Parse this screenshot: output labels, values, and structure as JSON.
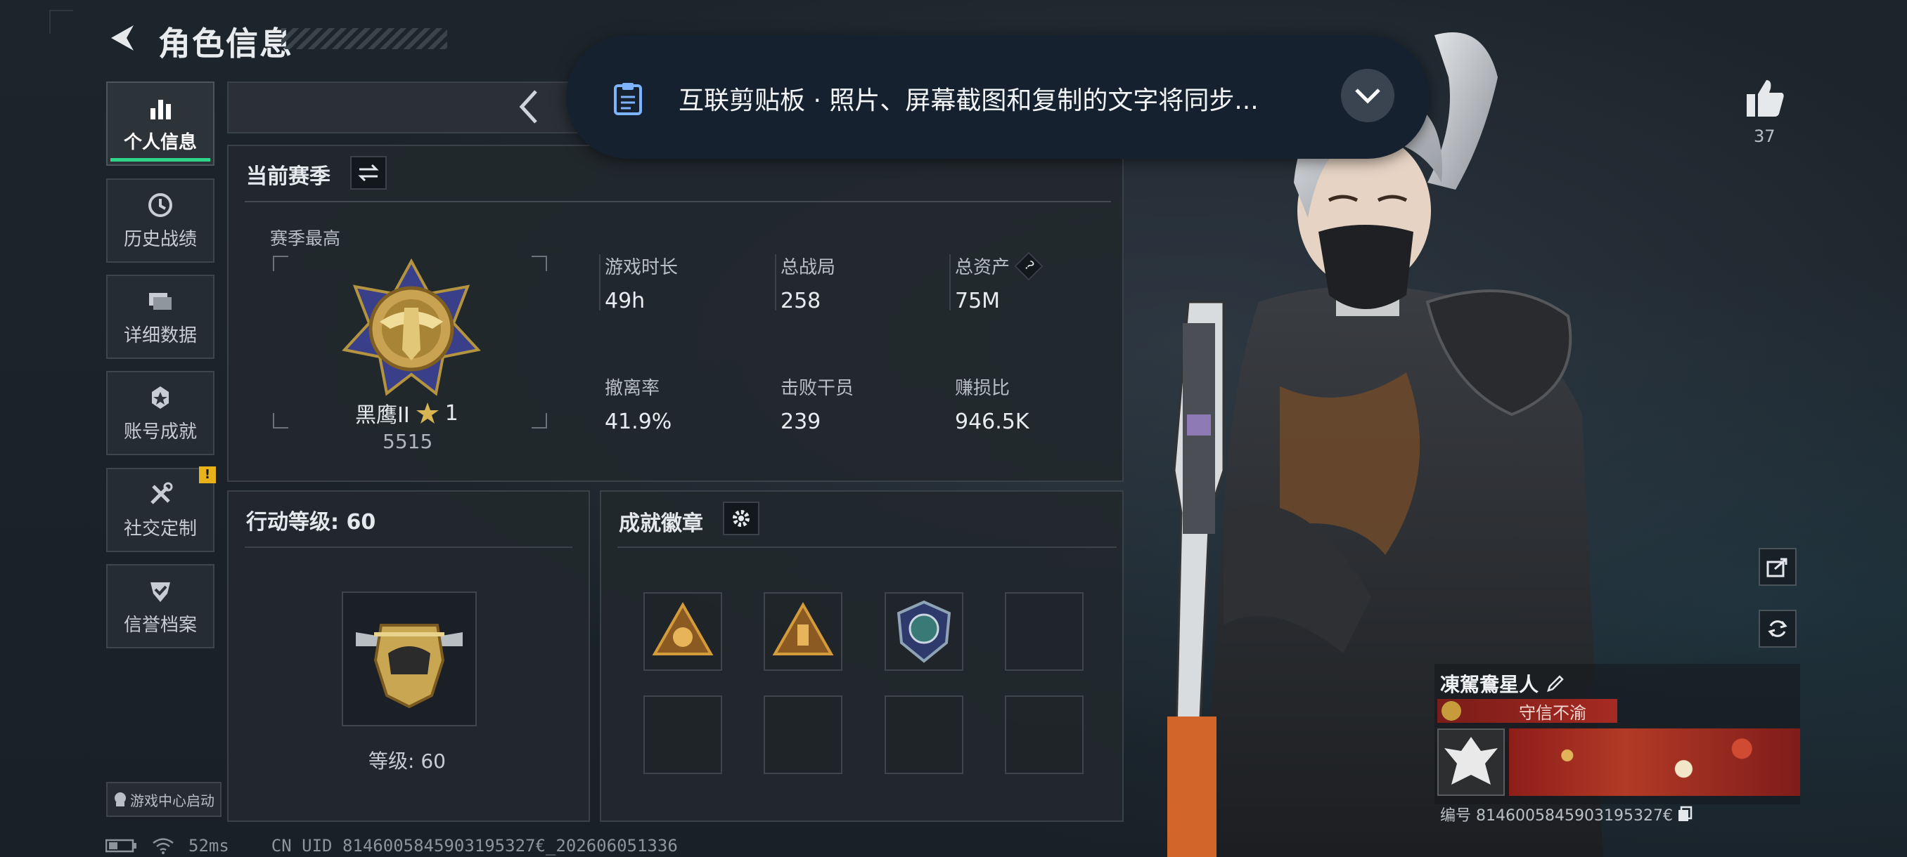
{
  "header": {
    "title": "角色信息"
  },
  "sidebar": {
    "items": [
      {
        "label": "个人信息",
        "icon": "bar-chart-icon",
        "active": true
      },
      {
        "label": "历史战绩",
        "icon": "history-clock-icon"
      },
      {
        "label": "详细数据",
        "icon": "folders-icon"
      },
      {
        "label": "账号成就",
        "icon": "medal-star-icon"
      },
      {
        "label": "社交定制",
        "icon": "wrench-tools-icon",
        "badge": "!"
      },
      {
        "label": "信誉档案",
        "icon": "shield-check-icon"
      }
    ],
    "game_center": "游戏中心启动"
  },
  "notification": {
    "text": "互联剪贴板 · 照片、屏幕截图和复制的文字将同步...",
    "icon": "clipboard-icon"
  },
  "season": {
    "section_label": "当前赛季",
    "best_label": "赛季最高",
    "rank_name": "黑鹰II",
    "rank_stars": "1",
    "rank_score": "5515",
    "stats": [
      {
        "label": "游戏时长",
        "value": "49h"
      },
      {
        "label": "总战局",
        "value": "258"
      },
      {
        "label": "总资产",
        "value": "75M",
        "help": "?"
      },
      {
        "label": "撤离率",
        "value": "41.9%"
      },
      {
        "label": "击败干员",
        "value": "239"
      },
      {
        "label": "赚损比",
        "value": "946.5K"
      }
    ]
  },
  "action_level": {
    "title": "行动等级: 60",
    "level_label": "等级: 60"
  },
  "achievements": {
    "title": "成就徽章"
  },
  "right": {
    "likes": "37",
    "player_name": "凍駕鴦星人",
    "title_tag": "守信不渝",
    "player_id": "编号 8146005845903195327€"
  },
  "footer": {
    "ping": "52ms",
    "uid": "CN UID 8146005845903195327€_202606051336"
  },
  "colors": {
    "accent": "#2fd58b",
    "warning": "#e9b218",
    "title_red": "#9a2520"
  }
}
